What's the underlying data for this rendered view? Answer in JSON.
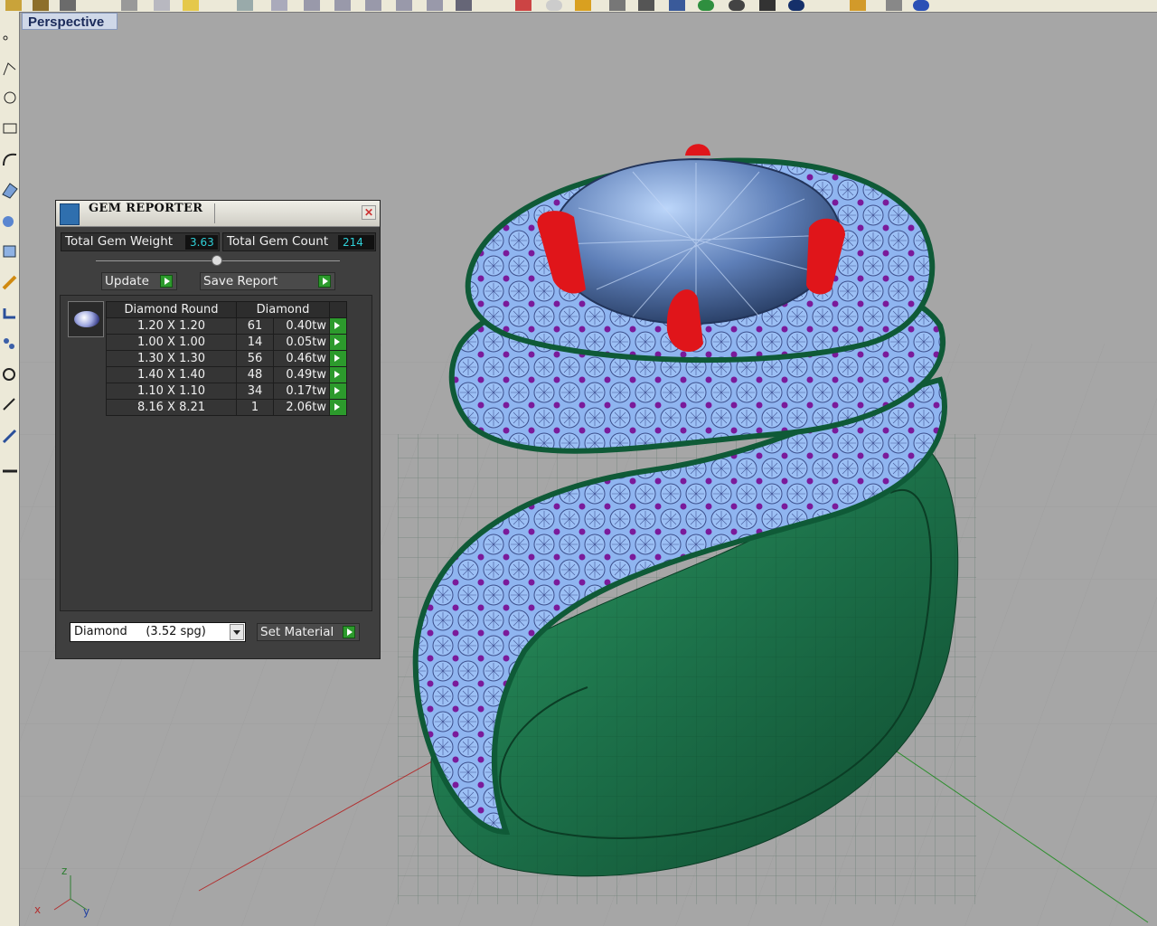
{
  "viewport": {
    "label": "Perspective"
  },
  "gem_reporter": {
    "title": "GEM REPORTER",
    "close_icon": "close-icon",
    "total_gem_weight_label": "Total Gem Weight",
    "total_gem_weight": "3.63",
    "total_gem_count_label": "Total Gem Count",
    "total_gem_count": "214",
    "update_label": "Update",
    "save_report_label": "Save Report",
    "table": {
      "headers": [
        "Diamond Round",
        "Diamond"
      ],
      "rows": [
        {
          "size": "1.20 X 1.20",
          "count": "61",
          "weight": "0.40tw"
        },
        {
          "size": "1.00 X 1.00",
          "count": "14",
          "weight": "0.05tw"
        },
        {
          "size": "1.30 X 1.30",
          "count": "56",
          "weight": "0.46tw"
        },
        {
          "size": "1.40 X 1.40",
          "count": "48",
          "weight": "0.49tw"
        },
        {
          "size": "1.10 X 1.10",
          "count": "34",
          "weight": "0.17tw"
        },
        {
          "size": "8.16 X 8.21",
          "count": "1",
          "weight": "2.06tw"
        }
      ]
    },
    "material_value": "Diamond     (3.52 spg)",
    "set_material_label": "Set Material"
  },
  "axes": {
    "z": "z",
    "x": "x",
    "y": "y"
  },
  "colors": {
    "viewport_bg": "#a6a6a6",
    "metal": "#1f7a4f",
    "stones": "#8ab4f0",
    "beads": "#7a1a9a",
    "prongs": "#e0151a",
    "accent_green": "#2c9a2c",
    "value_cyan": "#2fd0d8"
  }
}
